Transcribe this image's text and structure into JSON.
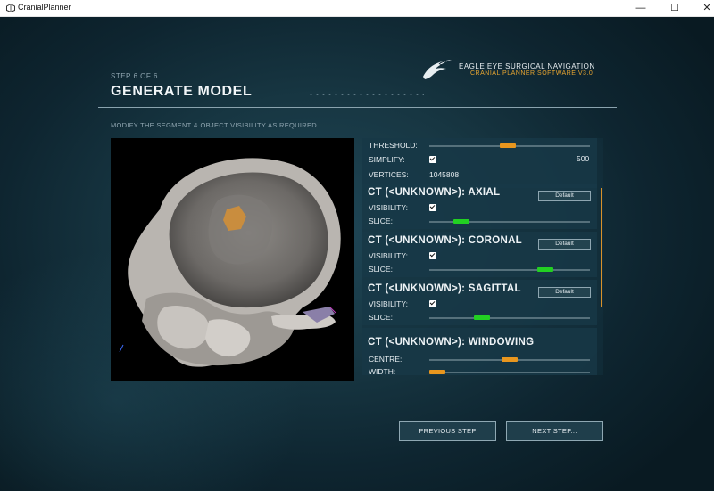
{
  "window": {
    "title": "CranialPlanner",
    "icon": "unity-icon",
    "controls": {
      "minimize": "—",
      "maximize": "☐",
      "close": "✕"
    }
  },
  "header": {
    "step": "STEP 6 OF 6",
    "title": "GENERATE MODEL",
    "brand_name": "EAGLE EYE SURGICAL NAVIGATION",
    "brand_sub": "CRANIAL PLANNER SOFTWARE V3.0"
  },
  "instructions": "MODIFY THE SEGMENT & OBJECT VISIBILITY AS REQUIRED...",
  "panel": {
    "threshold": {
      "label": "THRESHOLD:",
      "value_fraction": 0.49
    },
    "simplify": {
      "label": "SIMPLIFY:",
      "checked": true,
      "value": "500"
    },
    "vertices": {
      "label": "VERTICES:",
      "value": "1045808"
    },
    "sections": [
      {
        "title": "CT (<UNKNOWN>): AXIAL",
        "default_label": "Default",
        "visibility_label": "VISIBILITY:",
        "visible": true,
        "slice_label": "SLICE:",
        "slice_fraction": 0.2
      },
      {
        "title": "CT (<UNKNOWN>): CORONAL",
        "default_label": "Default",
        "visibility_label": "VISIBILITY:",
        "visible": true,
        "slice_label": "SLICE:",
        "slice_fraction": 0.72
      },
      {
        "title": "CT (<UNKNOWN>): SAGITTAL",
        "default_label": "Default",
        "visibility_label": "VISIBILITY:",
        "visible": true,
        "slice_label": "SLICE:",
        "slice_fraction": 0.33
      }
    ],
    "windowing": {
      "title": "CT (<UNKNOWN>): WINDOWING",
      "centre_label": "CENTRE:",
      "centre_fraction": 0.5,
      "width_label": "WIDTH:",
      "width_fraction": 0.05
    }
  },
  "footer": {
    "previous": "PREVIOUS STEP",
    "next": "NEXT STEP..."
  },
  "colors": {
    "accent_orange": "#e8961e",
    "accent_green": "#22d022",
    "background": "#173642"
  }
}
